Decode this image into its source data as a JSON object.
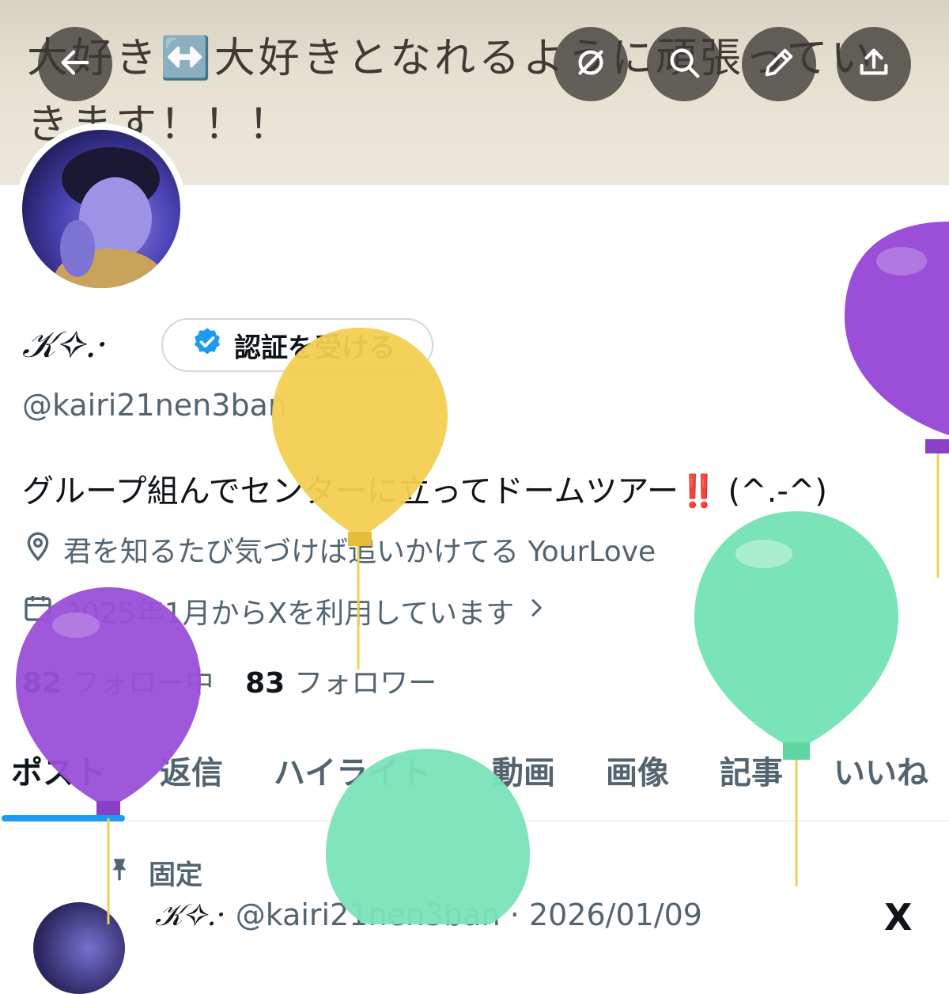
{
  "banner": {
    "text": "大好き↔️大好きとなれるように頑張っていきます！！！"
  },
  "header_buttons": {
    "back": "back-arrow-icon",
    "grok": "grok-icon",
    "search": "search-icon",
    "edit": "edit-pencil-icon",
    "share": "share-upload-icon"
  },
  "profile": {
    "display_name": "𝒦✧.·",
    "verify_button_label": "認証を受ける",
    "handle": "@kairi21nen3ban",
    "bio_text": "グループ組んでセンターに立ってドームツアー",
    "bio_emoji": "‼️",
    "bio_suffix": " (^.-^)",
    "location": "君を知るたび気づけば追いかけてる YourLove",
    "joined": "2025年1月からXを利用しています",
    "following_count": "82",
    "following_label": "フォロー中",
    "followers_count": "83",
    "followers_label": "フォロワー"
  },
  "tabs": [
    {
      "label": "ポスト",
      "active": true
    },
    {
      "label": "返信",
      "active": false
    },
    {
      "label": "ハイライト",
      "active": false
    },
    {
      "label": "動画",
      "active": false
    },
    {
      "label": "画像",
      "active": false
    },
    {
      "label": "記事",
      "active": false
    },
    {
      "label": "いいね",
      "active": false
    }
  ],
  "pinned_post": {
    "pinned_label": "固定",
    "author_name": "𝒦✧.·",
    "author_handle": "@kairi21nen3ban",
    "separator": "·",
    "date": "2026/01/09",
    "platform_mark": "X"
  },
  "colors": {
    "accent": "#1d9bf0",
    "verified": "#1d9bf0",
    "balloon_purple": "#9b4fd8",
    "balloon_yellow": "#f2cf52",
    "balloon_green": "#7ae3b8"
  }
}
